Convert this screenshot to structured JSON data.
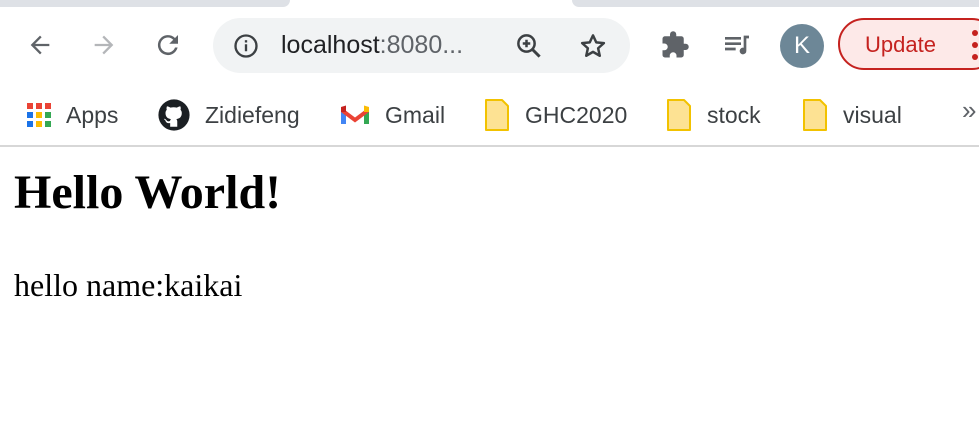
{
  "browser": {
    "url_host": "localhost",
    "url_rest": ":8080...",
    "profile_initial": "K",
    "update_label": "Update",
    "icons": {
      "back": "back-arrow-icon",
      "forward": "forward-arrow-icon",
      "reload": "reload-icon",
      "site_info": "info-icon",
      "zoom": "zoom-in-icon",
      "bookmark_star": "star-icon",
      "extensions": "puzzle-icon",
      "media": "playlist-music-icon",
      "menu": "three-dots-icon"
    }
  },
  "bookmarks": {
    "items": [
      {
        "label": "Apps",
        "icon": "apps-grid-icon"
      },
      {
        "label": "Zidiefeng",
        "icon": "github-icon"
      },
      {
        "label": "Gmail",
        "icon": "gmail-icon"
      },
      {
        "label": "GHC2020",
        "icon": "folder-icon"
      },
      {
        "label": "stock",
        "icon": "folder-icon"
      },
      {
        "label": "visual",
        "icon": "folder-icon"
      }
    ],
    "overflow": "»"
  },
  "page": {
    "heading": "Hello World!",
    "text": "hello name:kaikai"
  },
  "colors": {
    "update_accent": "#c5221f",
    "avatar_bg": "#6d8797",
    "omnibox_bg": "#f1f3f4",
    "tab_bg": "#dee1e6"
  }
}
